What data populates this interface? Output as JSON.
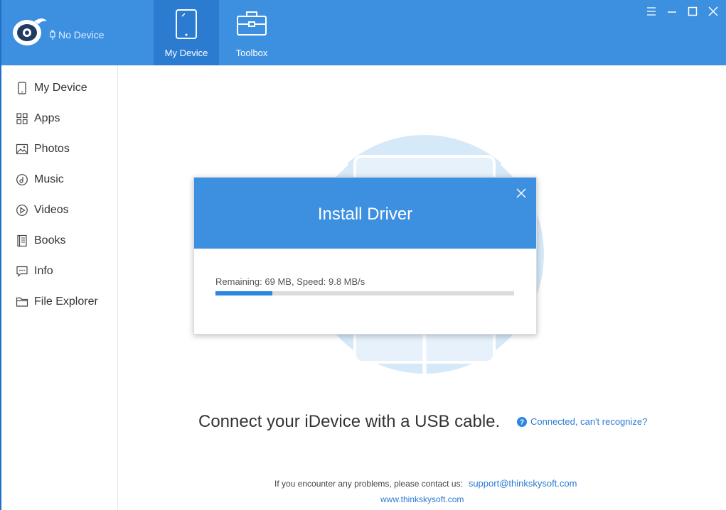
{
  "header": {
    "device_status": "No Device",
    "tabs": [
      {
        "label": "My Device",
        "icon": "tablet-icon",
        "active": true
      },
      {
        "label": "Toolbox",
        "icon": "toolbox-icon",
        "active": false
      }
    ],
    "window_controls": [
      "menu-icon",
      "minimize-icon",
      "maximize-icon",
      "close-icon"
    ]
  },
  "sidebar": {
    "items": [
      {
        "label": "My Device",
        "icon": "phone-icon"
      },
      {
        "label": "Apps",
        "icon": "grid-icon"
      },
      {
        "label": "Photos",
        "icon": "photo-icon"
      },
      {
        "label": "Music",
        "icon": "music-icon"
      },
      {
        "label": "Videos",
        "icon": "play-icon"
      },
      {
        "label": "Books",
        "icon": "book-icon"
      },
      {
        "label": "Info",
        "icon": "chat-icon"
      },
      {
        "label": "File Explorer",
        "icon": "folder-icon"
      }
    ]
  },
  "dialog": {
    "title": "Install Driver",
    "progress_text": "Remaining: 69 MB, Speed: 9.8 MB/s",
    "progress_fraction": 0.19
  },
  "main": {
    "connect_text": "Connect your iDevice with a USB cable.",
    "help_link": "Connected, can't recognize?"
  },
  "footer": {
    "contact_text": "If you encounter any problems, please contact us:",
    "support_email": "support@thinkskysoft.com",
    "website": "www.thinkskysoft.com"
  },
  "colors": {
    "accent": "#3d8fe0",
    "accent_dark": "#2b7bd0",
    "link": "#2b7bd0"
  }
}
